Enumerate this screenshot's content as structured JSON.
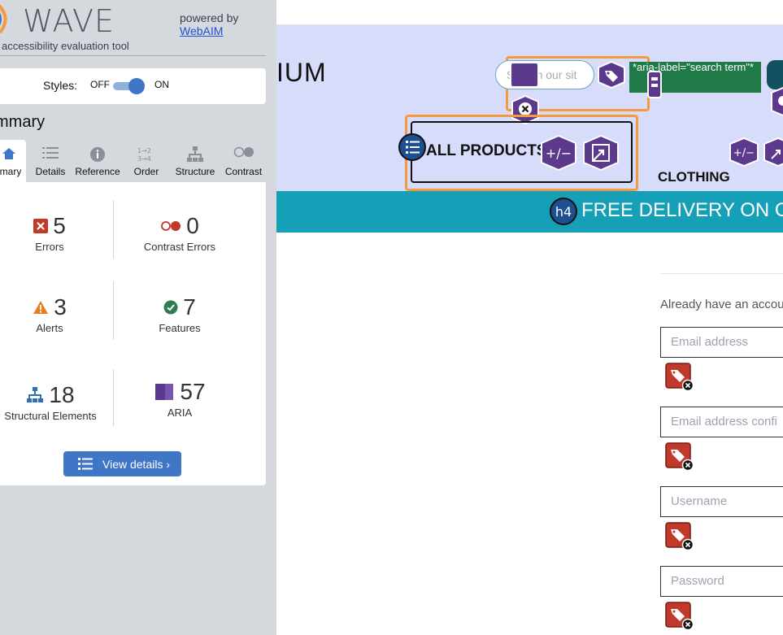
{
  "wave": {
    "title": "WAVE",
    "tagline": "accessibility evaluation tool",
    "powered_by": "powered by",
    "webaim_link": "WebAIM",
    "styles_label": "Styles:",
    "styles_off": "OFF",
    "styles_on": "ON",
    "styles_on_state": true,
    "summary_heading": "mmary",
    "tabs": [
      {
        "label": "mary",
        "icon": "home-icon",
        "active": true
      },
      {
        "label": "Details",
        "icon": "list-icon",
        "active": false
      },
      {
        "label": "Reference",
        "icon": "info-icon",
        "active": false
      },
      {
        "label": "Order",
        "icon": "order-icon",
        "active": false
      },
      {
        "label": "Structure",
        "icon": "hierarchy-icon",
        "active": false
      },
      {
        "label": "Contrast",
        "icon": "contrast-icon",
        "active": false
      }
    ],
    "stats": {
      "errors": {
        "count": "5",
        "label": "Errors",
        "color": "#c0392b"
      },
      "contrast_errors": {
        "count": "0",
        "label": "Contrast Errors",
        "color": "#c0392b"
      },
      "alerts": {
        "count": "3",
        "label": "Alerts",
        "color": "#e67e22"
      },
      "features": {
        "count": "7",
        "label": "Features",
        "color": "#2e7d4f"
      },
      "structural": {
        "count": "18",
        "label": "Structural Elements",
        "color": "#2f6fb5"
      },
      "aria": {
        "count": "57",
        "label": "ARIA",
        "color": "#5b3a8e"
      }
    },
    "view_details": "View details ›"
  },
  "site": {
    "brand": "IUM",
    "search_placeholder": "Search our sit",
    "aria_label_text": "*aria-label=\"search term\"*",
    "nav_all_products": "ALL PRODUCTS",
    "nav_clothing": "CLOTHING",
    "h4_badge": "h4",
    "band_text": "FREE DELIVERY ON OR",
    "already_text": "Already have an accou",
    "fields": [
      {
        "placeholder": "Email address"
      },
      {
        "placeholder": "Email address confi"
      },
      {
        "placeholder": "Username"
      },
      {
        "placeholder": "Password"
      }
    ]
  },
  "colors": {
    "wave_bg": "#d5d8dd",
    "accent_blue": "#3f76c6",
    "header_bg": "#d7dcfa",
    "band_bg": "#16a0b7",
    "highlight_orange": "#f39b3c",
    "aria_purple": "#5b3a8e",
    "error_red": "#c0392b"
  }
}
